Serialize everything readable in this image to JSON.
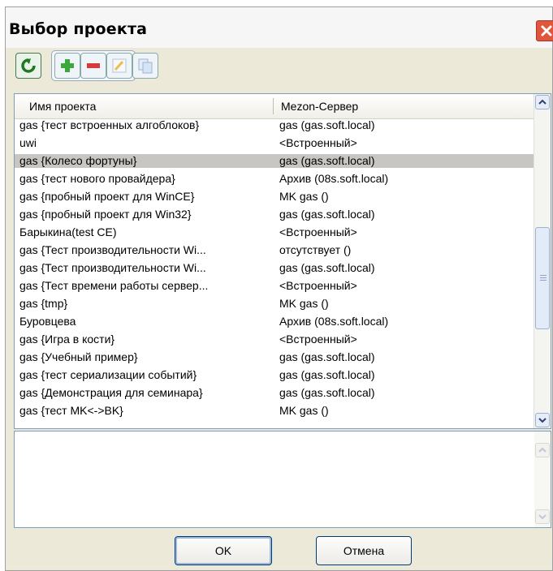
{
  "window": {
    "title": "Выбор проекта"
  },
  "toolbar": {
    "buttons": [
      {
        "icon": "refresh-icon"
      },
      {
        "icon": "add-icon"
      },
      {
        "icon": "remove-icon"
      },
      {
        "icon": "edit-icon"
      },
      {
        "icon": "copy-icon"
      }
    ]
  },
  "table": {
    "columns": [
      "Имя проекта",
      "Mezon-Сервер"
    ],
    "selected_row": 2,
    "rows": [
      [
        "gas {тест встроенных алгоблоков}",
        "gas (gas.soft.local)"
      ],
      [
        "uwi",
        "<Встроенный>"
      ],
      [
        "gas {Колесо фортуны}",
        "gas (gas.soft.local)"
      ],
      [
        "gas {тест нового провайдера}",
        "Архив (08s.soft.local)"
      ],
      [
        "gas {пробный проект для WinCE}",
        "MK gas ()"
      ],
      [
        "gas {пробный проект для Win32}",
        "gas (gas.soft.local)"
      ],
      [
        "Барыкина(test CE)",
        "<Встроенный>"
      ],
      [
        "gas {Тест производительности Wi...",
        "отсутствует ()"
      ],
      [
        "gas {Тест производительности Wi...",
        "gas (gas.soft.local)"
      ],
      [
        "gas {Тест времени работы сервер...",
        "<Встроенный>"
      ],
      [
        "gas {tmp}",
        "MK gas ()"
      ],
      [
        "Буровцева",
        "Архив (08s.soft.local)"
      ],
      [
        "gas {Игра в кости}",
        "<Встроенный>"
      ],
      [
        "gas {Учебный пример}",
        "gas (gas.soft.local)"
      ],
      [
        "gas {тест сериализации событий}",
        "gas (gas.soft.local)"
      ],
      [
        "gas {Демонстрация для семинара}",
        "gas (gas.soft.local)"
      ],
      [
        "gas {тест MK<->BK}",
        "MK gas ()"
      ]
    ]
  },
  "description": {
    "value": ""
  },
  "buttons": {
    "ok": "OK",
    "cancel": "Отмена"
  },
  "colors": {
    "selection": "#c7c6c2",
    "close": "#e0563b",
    "dialog_bg": "#ece9d8"
  }
}
